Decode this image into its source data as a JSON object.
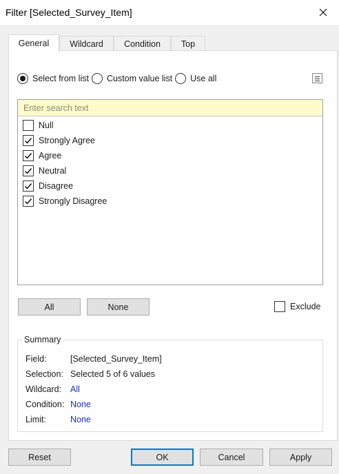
{
  "window": {
    "title": "Filter [Selected_Survey_Item]"
  },
  "tabs": [
    {
      "label": "General"
    },
    {
      "label": "Wildcard"
    },
    {
      "label": "Condition"
    },
    {
      "label": "Top"
    }
  ],
  "mode": {
    "options": [
      {
        "label": "Select from list",
        "selected": true
      },
      {
        "label": "Custom value list",
        "selected": false
      },
      {
        "label": "Use all",
        "selected": false
      }
    ],
    "menu_icon": "list-menu-icon"
  },
  "search": {
    "placeholder": "Enter search text",
    "value": ""
  },
  "items": [
    {
      "label": "Null",
      "checked": false
    },
    {
      "label": "Strongly Agree",
      "checked": true
    },
    {
      "label": "Agree",
      "checked": true
    },
    {
      "label": "Neutral",
      "checked": true
    },
    {
      "label": "Disagree",
      "checked": true
    },
    {
      "label": "Strongly Disagree",
      "checked": true
    }
  ],
  "buttons": {
    "all": "All",
    "none": "None",
    "exclude": "Exclude"
  },
  "summary": {
    "title": "Summary",
    "field_label": "Field:",
    "field_value": "[Selected_Survey_Item]",
    "selection_label": "Selection:",
    "selection_value": "Selected 5 of 6 values",
    "wildcard_label": "Wildcard:",
    "wildcard_value": "All",
    "condition_label": "Condition:",
    "condition_value": "None",
    "limit_label": "Limit:",
    "limit_value": "None"
  },
  "footer": {
    "reset": "Reset",
    "ok": "OK",
    "cancel": "Cancel",
    "apply": "Apply"
  },
  "colors": {
    "link": "#1c2dbd",
    "search_bg": "#fdfbc9",
    "primary_border": "#0078d7"
  }
}
